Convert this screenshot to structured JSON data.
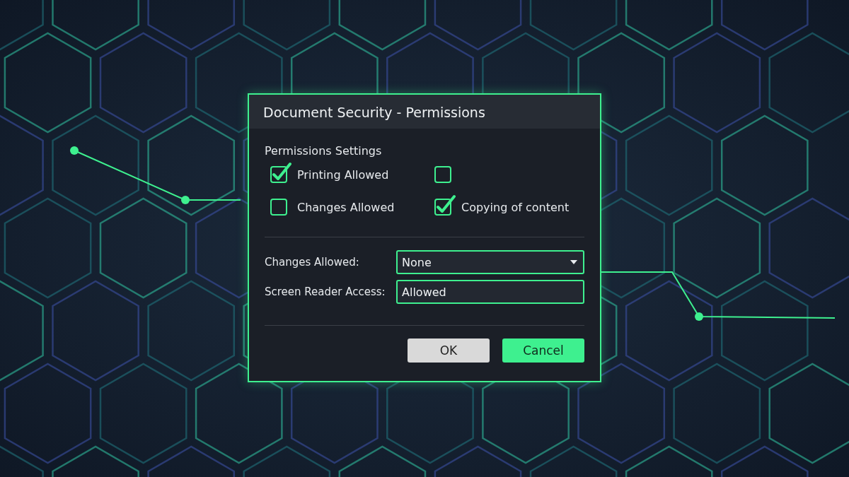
{
  "dialog": {
    "title": "Document Security - Permissions",
    "section_title": "Permissions Settings",
    "checkboxes": [
      {
        "label": "Printing Allowed",
        "checked": true
      },
      {
        "checked": false
      },
      {
        "label": "Changes Allowed",
        "checked": false
      },
      {
        "label": "Copying of content",
        "checked": true
      }
    ],
    "fields": [
      {
        "kind": "dropdown",
        "label": "Changes Allowed:",
        "value": "None"
      },
      {
        "kind": "text",
        "label": "Screen Reader Access:",
        "value": "Allowed"
      }
    ],
    "buttons": [
      {
        "kind": "secondary",
        "label": "OK"
      },
      {
        "kind": "primary",
        "label": "Cancel"
      }
    ]
  }
}
